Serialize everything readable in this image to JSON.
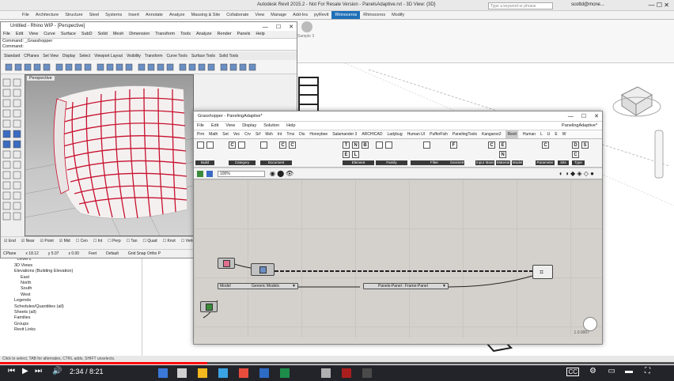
{
  "revit": {
    "title": "Autodesk Revit 2015.2 - Not For Resale Version - PanelsAdaptive.rvt - 3D View: {3D}",
    "search_placeholder": "Type a keyword or phrase",
    "user": "scottd@mcne...",
    "tabs": [
      "File",
      "Architecture",
      "Structure",
      "Steel",
      "Systems",
      "Insert",
      "Annotate",
      "Analyze",
      "Massing & Site",
      "Collaborate",
      "View",
      "Manage",
      "Add-Ins",
      "pyRevit",
      "Rhinoceros",
      "Rhinoceros",
      "Modify"
    ],
    "active_tab_index": 14,
    "ribbon_button": "Sample 3",
    "browser": [
      "Level 1",
      "Level 2",
      "3D Views",
      "Elevations (Building Elevation)",
      "East",
      "North",
      "South",
      "West",
      "Legends",
      "Schedules/Quantities (all)",
      "Sheets (all)",
      "Families",
      "Groups",
      "Revit Links"
    ],
    "status": "Click to select, TAB for alternates, CTRL adds, SHIFT unselects."
  },
  "rhino": {
    "title": "Untitled - Rhino WIP - [Perspective]",
    "menu": [
      "File",
      "Edit",
      "View",
      "Curve",
      "Surface",
      "SubD",
      "Solid",
      "Mesh",
      "Dimension",
      "Transform",
      "Tools",
      "Analyze",
      "Render",
      "Panels",
      "Help"
    ],
    "cmd_line1": "Command: _Grasshopper",
    "cmd_line2": "Command:",
    "tabs": [
      "Standard",
      "CPlanes",
      "Set View",
      "Display",
      "Select",
      "Viewport Layout",
      "Visibility",
      "Transform",
      "Curve Tools",
      "Surface Tools",
      "Solid Tools"
    ],
    "viewport_label": "Perspective",
    "osnaps": [
      "End",
      "Near",
      "Point",
      "Mid",
      "Cen",
      "Int",
      "Perp",
      "Tan",
      "Quad",
      "Knot",
      "Vertex",
      "Pro"
    ],
    "status": [
      "CPlane",
      "x 18.12",
      "y 5.07",
      "z 0.00",
      "Feet",
      "Default",
      "Grid Snap  Ortho  P"
    ]
  },
  "grasshopper": {
    "title": "Grasshopper - PanelingAdaptive*",
    "menu": [
      "File",
      "Edit",
      "View",
      "Display",
      "Solution",
      "Help"
    ],
    "doc_name": "PanelingAdaptive*",
    "tabs": [
      "Prm",
      "Math",
      "Set",
      "Vec",
      "Crv",
      "Srf",
      "Msh",
      "Int",
      "Trns",
      "Dis",
      "Honeybee",
      "Salamander 3",
      "ARCHICAD",
      "Ladybug",
      "Human UI",
      "PufferFish",
      "PanelingTools",
      "Kangaroo2",
      "Revit",
      "Human",
      "L",
      "U",
      "E",
      "W"
    ],
    "active_tab_index": 18,
    "groups": [
      "Build",
      "Category",
      "Document",
      "Element",
      "Family",
      "Filter",
      "Geometry",
      "Input",
      "Mass",
      "Material",
      "Model",
      "Parameter",
      "Site",
      "Type"
    ],
    "zoom": "100%",
    "nodes": {
      "picker1": "Model",
      "picker1_value": "Generic Models",
      "picker2_value": "Panels-Panel : Frame-Panel"
    },
    "version": "1.0.0007"
  },
  "player": {
    "time": "2:34 / 8:21",
    "progress": 0.307
  }
}
